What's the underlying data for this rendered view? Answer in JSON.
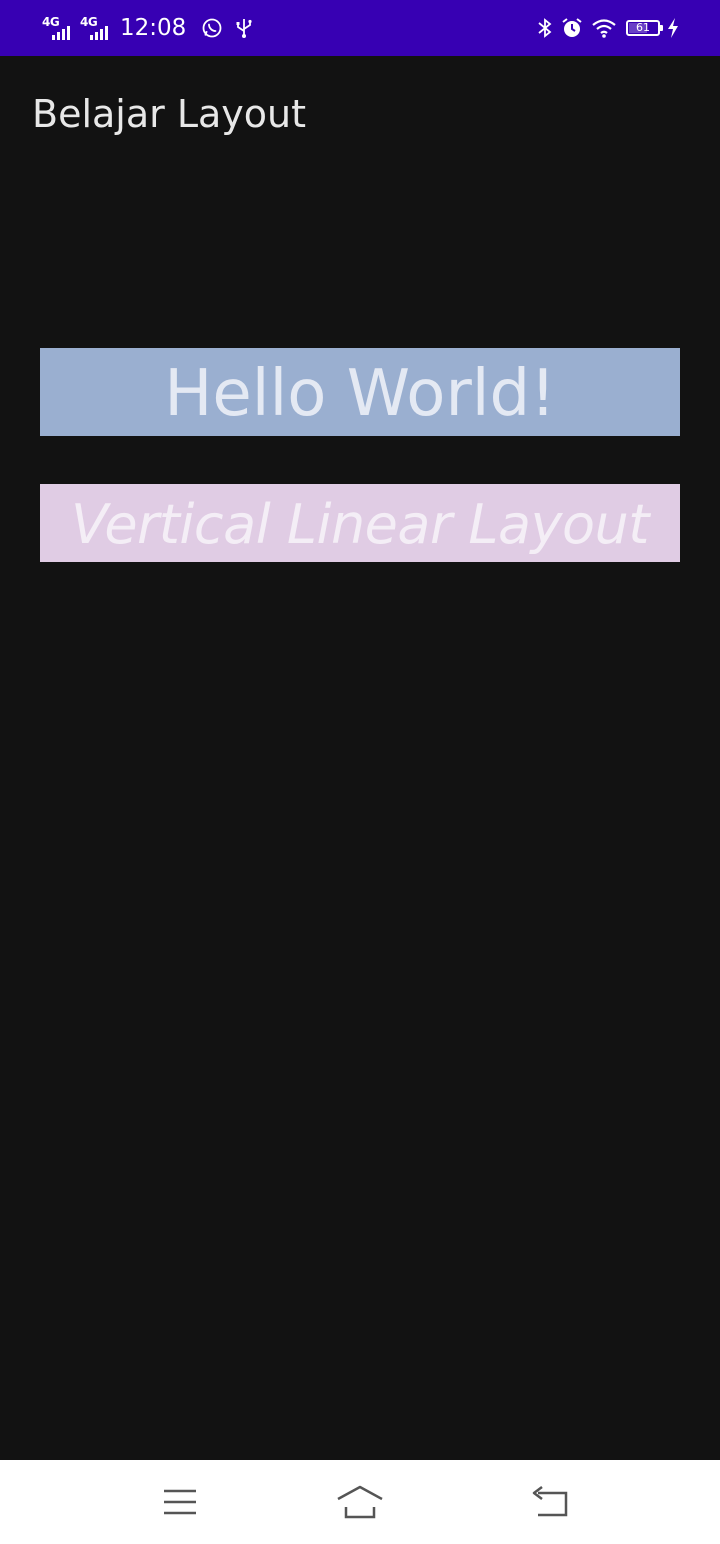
{
  "status_bar": {
    "time": "12:08",
    "network_1": "4G",
    "network_2": "4G",
    "battery_level": "61",
    "icons": [
      "signal-icon",
      "signal-icon",
      "whatsapp-icon",
      "usb-icon",
      "bluetooth-icon",
      "alarm-icon",
      "wifi-icon",
      "battery-icon",
      "charging-icon"
    ],
    "background_color": "#3700b3"
  },
  "app_bar": {
    "title": "Belajar Layout"
  },
  "content": {
    "hello_text": "Hello World!",
    "hello_bg_color": "#9aafd0",
    "vertical_text": "Vertical Linear Layout",
    "vertical_bg_color": "#e0cce4"
  },
  "nav_bar": {
    "icons": [
      "menu-icon",
      "home-icon",
      "back-icon"
    ]
  }
}
